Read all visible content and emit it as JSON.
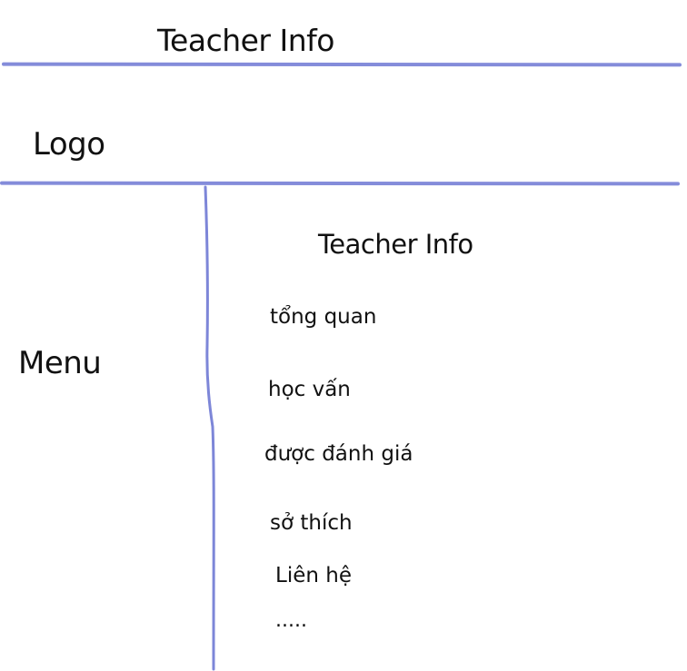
{
  "header": {
    "title": "Teacher Info",
    "logo_label": "Logo"
  },
  "sidebar": {
    "label": "Menu"
  },
  "main": {
    "title": "Teacher Info",
    "items": [
      {
        "label": "tổng quan"
      },
      {
        "label": "học vấn"
      },
      {
        "label": "được đánh giá"
      },
      {
        "label": "sở thích"
      },
      {
        "label": "Liên hệ"
      },
      {
        "label": "....."
      }
    ]
  },
  "colors": {
    "line": "#7d86d8",
    "text": "#111111",
    "background": "#ffffff"
  }
}
